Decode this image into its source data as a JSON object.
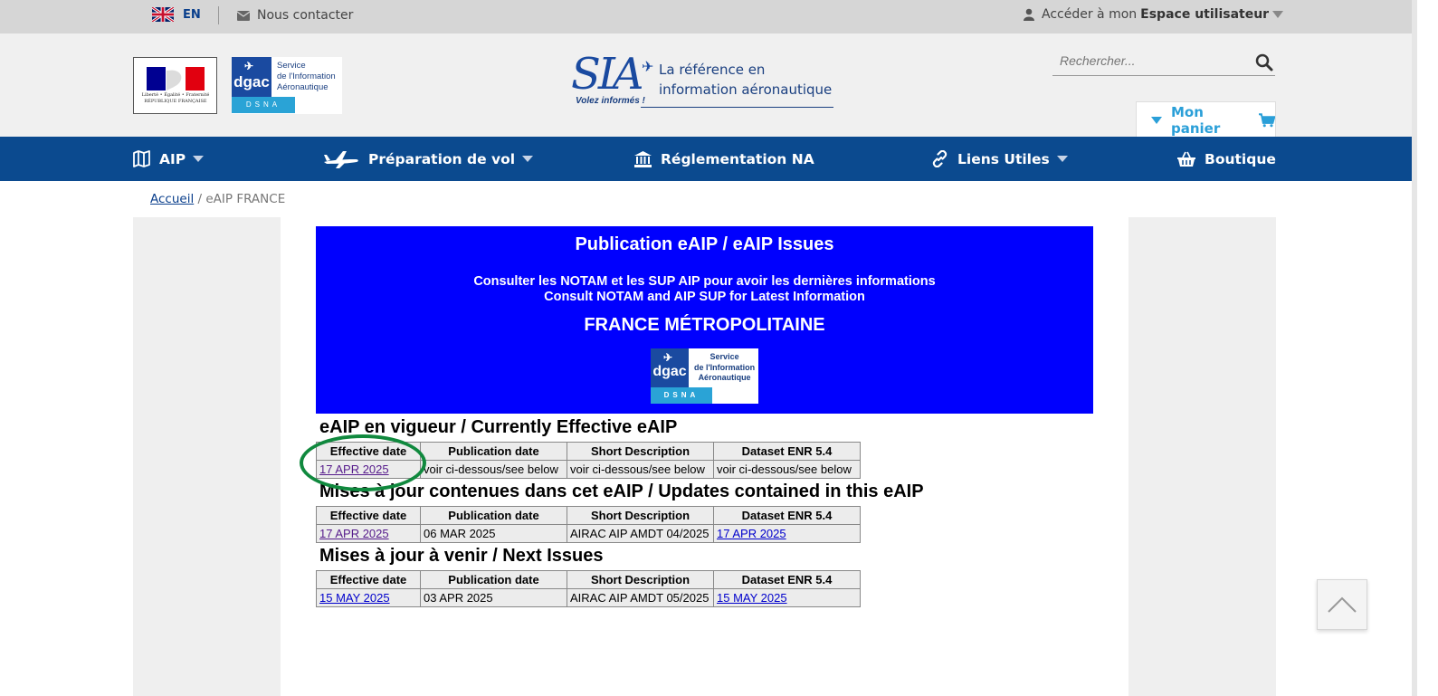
{
  "topbar": {
    "lang_code": "EN",
    "contact_label": "Nous contacter",
    "user_access_prefix": "Accéder à mon",
    "user_access_bold": "Espace utilisateur"
  },
  "header": {
    "marianne_text": "Liberté • Égalité • Fraternité RÉPUBLIQUE FRANÇAISE",
    "dgac_word": "dgac",
    "dgac_service_lines": [
      "Service",
      "de l'Information",
      "Aéronautique"
    ],
    "dgac_dsna": "DSNA",
    "sia_letters": "SIA",
    "sia_tagline_1": "La référence en",
    "sia_tagline_2": "information aéronautique",
    "sia_motto": "Volez informés !",
    "search_placeholder": "Rechercher...",
    "cart_label": "Mon panier"
  },
  "nav": {
    "items": [
      {
        "label": "AIP",
        "icon": "map-book-icon"
      },
      {
        "label": "Préparation de vol",
        "icon": "airplane-icon"
      },
      {
        "label": "Réglementation NA",
        "icon": "institution-icon"
      },
      {
        "label": "Liens Utiles",
        "icon": "link-icon"
      },
      {
        "label": "Boutique",
        "icon": "basket-icon"
      }
    ]
  },
  "breadcrumb": {
    "home": "Accueil",
    "separator": "/",
    "current": "eAIP FRANCE"
  },
  "banner": {
    "title": "Publication eAIP / eAIP Issues",
    "line1": "Consulter les NOTAM et les SUP AIP pour avoir les dernières informations",
    "line2": "Consult NOTAM and AIP SUP for Latest Information",
    "region": "FRANCE MÉTROPOLITAINE"
  },
  "columns": [
    "Effective date",
    "Publication date",
    "Short Description",
    "Dataset ENR 5.4"
  ],
  "sections": [
    {
      "heading": "eAIP en vigueur / Currently Effective eAIP",
      "row": [
        "17 APR 2025",
        "voir ci-dessous/see below",
        "voir ci-dessous/see below",
        "voir ci-dessous/see below"
      ]
    },
    {
      "heading": "Mises à jour contenues dans cet eAIP / Updates contained in this eAIP",
      "row": [
        "17 APR 2025",
        "06 MAR 2025",
        "AIRAC AIP AMDT 04/2025",
        "17 APR 2025"
      ]
    },
    {
      "heading": "Mises à jour à venir / Next Issues",
      "row": [
        "15 MAY 2025",
        "03 APR 2025",
        "AIRAC AIP AMDT 05/2025",
        "15 MAY 2025"
      ]
    }
  ],
  "colors": {
    "nav_bg": "#0b4a8f",
    "banner_bg": "#0000fe",
    "highlight_circle": "#10893e",
    "cart_accent": "#2a9fd8"
  }
}
